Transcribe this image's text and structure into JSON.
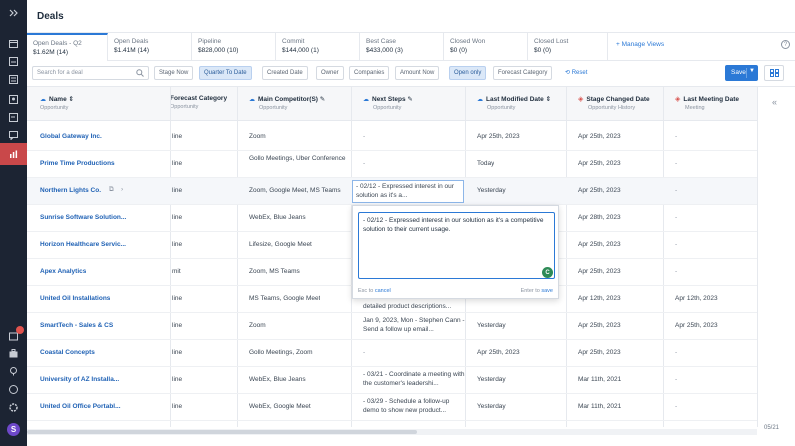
{
  "header": {
    "title": "Deals"
  },
  "tabs": [
    {
      "label": "Open Deals - Q2",
      "value": "$1.62M (14)"
    },
    {
      "label": "Open Deals",
      "value": "$1.41M (14)"
    },
    {
      "label": "Pipeline",
      "value": "$828,000 (10)"
    },
    {
      "label": "Commit",
      "value": "$144,000 (1)"
    },
    {
      "label": "Best Case",
      "value": "$433,000 (3)"
    },
    {
      "label": "Closed Won",
      "value": "$0 (0)"
    },
    {
      "label": "Closed Lost",
      "value": "$0 (0)"
    }
  ],
  "manage_views": "+ Manage Views",
  "help": "?",
  "toolbar": {
    "search_placeholder": "Search for a deal",
    "chips": [
      "Stage Now",
      "Quarter To Date",
      "Created Date",
      "Owner",
      "Companies",
      "Amount Now",
      "Open only",
      "Forecast Category"
    ],
    "reset": "Reset",
    "save": "Save"
  },
  "columns": [
    {
      "label": "Name",
      "sub": "Opportunity"
    },
    {
      "label": "Forecast Category",
      "sub": "Opportunity"
    },
    {
      "label": "Main Competitor(S)",
      "sub": "Opportunity"
    },
    {
      "label": "Next Steps",
      "sub": "Opportunity"
    },
    {
      "label": "Last Modified Date",
      "sub": "Opportunity"
    },
    {
      "label": "Stage Changed Date",
      "sub": "Opportunity History"
    },
    {
      "label": "Last Meeting Date",
      "sub": "Meeting"
    }
  ],
  "rows": [
    {
      "name": "Global Gateway Inc.",
      "forecast": "line",
      "competitor": "Zoom",
      "next": "-",
      "modified": "Apr 25th, 2023",
      "stage": "Apr 25th, 2023",
      "meeting": "-"
    },
    {
      "name": "Prime Time Productions",
      "forecast": "line",
      "competitor": "Gollo Meetings, Uber Conference",
      "next": "-",
      "modified": "Today",
      "stage": "Apr 25th, 2023",
      "meeting": "-"
    },
    {
      "name": "Northern Lights Co.",
      "forecast": "line",
      "competitor": "Zoom, Google Meet, MS Teams",
      "next": "- 02/12 - Expressed interest in our solution as it's a...",
      "modified": "Yesterday",
      "stage": "Apr 25th, 2023",
      "meeting": "-"
    },
    {
      "name": "Sunrise Software Solution...",
      "forecast": "line",
      "competitor": "WebEx, Blue Jeans",
      "next": "",
      "modified": "",
      "stage": "Apr 28th, 2023",
      "meeting": "-"
    },
    {
      "name": "Horizon Healthcare Servic...",
      "forecast": "line",
      "competitor": "Lifesize, Google Meet",
      "next": "",
      "modified": "",
      "stage": "Apr 25th, 2023",
      "meeting": "-"
    },
    {
      "name": "Apex Analytics",
      "forecast": "mit",
      "competitor": "Zoom, MS Teams",
      "next": "",
      "modified": "",
      "stage": "Apr 25th, 2023",
      "meeting": "-"
    },
    {
      "name": "United Oil Installations",
      "forecast": "line",
      "competitor": "MS Teams, Google Meet",
      "next": "detailed product descriptions...",
      "modified": "",
      "stage": "Apr 12th, 2023",
      "meeting": "Apr 12th, 2023"
    },
    {
      "name": "SmartTech - Sales & CS",
      "forecast": "line",
      "competitor": "Zoom",
      "next": "Jan 9, 2023, Mon - Stephen Cann - Send a follow up email...",
      "modified": "Yesterday",
      "stage": "Apr 25th, 2023",
      "meeting": "Apr 25th, 2023"
    },
    {
      "name": "Coastal Concepts",
      "forecast": "line",
      "competitor": "Gollo Meetings, Zoom",
      "next": "-",
      "modified": "Apr 25th, 2023",
      "stage": "Apr 25th, 2023",
      "meeting": "-"
    },
    {
      "name": "University of AZ Installa...",
      "forecast": "line",
      "competitor": "WebEx, Blue Jeans",
      "next": "- 03/21 - Coordinate a meeting with the customer's leadershi...",
      "modified": "Yesterday",
      "stage": "Mar 11th, 2021",
      "meeting": "-"
    },
    {
      "name": "United Oil Office Portabl...",
      "forecast": "line",
      "competitor": "WebEx, Google Meet",
      "next": "- 03/29 - Schedule a follow-up demo to show new product...",
      "modified": "Yesterday",
      "stage": "Mar 11th, 2021",
      "meeting": "-"
    }
  ],
  "editor": {
    "text": "- 02/12 - Expressed interest in our solution as it's a competitive solution to their current usage.",
    "hint_left_prefix": "Esc to",
    "hint_left_action": "cancel",
    "hint_right_prefix": "Enter to",
    "hint_right_action": "save",
    "badge": "C"
  },
  "pager": "05/21",
  "rail": {
    "avatar": "S"
  }
}
